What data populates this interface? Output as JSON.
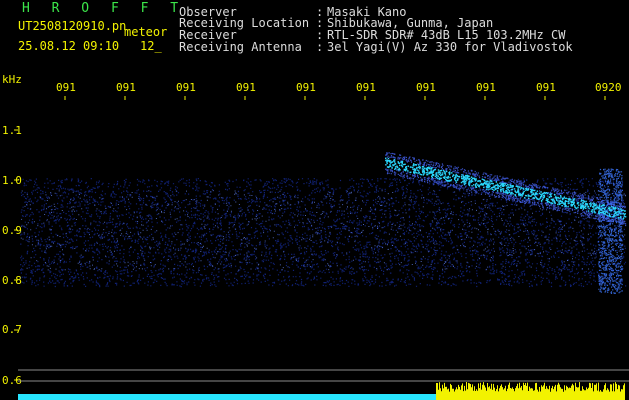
{
  "header": {
    "logo_text": "H R O F F T",
    "filename": "UT2508120910.pn",
    "tag": "meteor",
    "datetime": "25.08.12 09:10",
    "counter": "12_",
    "fields": [
      {
        "label": "Observer",
        "sep": ":",
        "value": "Masaki Kano"
      },
      {
        "label": "Receiving Location",
        "sep": ":",
        "value": "Shibukawa, Gunma, Japan"
      },
      {
        "label": "Receiver",
        "sep": ":",
        "value": "RTL-SDR SDR# 43dB L15 103.2MHz CW"
      },
      {
        "label": "Receiving Antenna",
        "sep": ":",
        "value": "3el Yagi(V) Az 330 for Vladivostok"
      }
    ]
  },
  "axis": {
    "y_unit": "kHz",
    "y_ticks": [
      "1.1",
      "1.0",
      "0.9",
      "0.8",
      "0.7",
      "0.6"
    ],
    "x_ticks": [
      "091",
      "091",
      "091",
      "091",
      "091",
      "091",
      "091",
      "091",
      "091",
      "0920"
    ]
  },
  "colors": {
    "background": "#000000",
    "label_yellow": "#f2f200",
    "logo_green": "#3ce64a",
    "noise_blue": "#1e3cd2",
    "signal_cyan": "#28e6ff",
    "level_yellow": "#f2f200"
  }
}
